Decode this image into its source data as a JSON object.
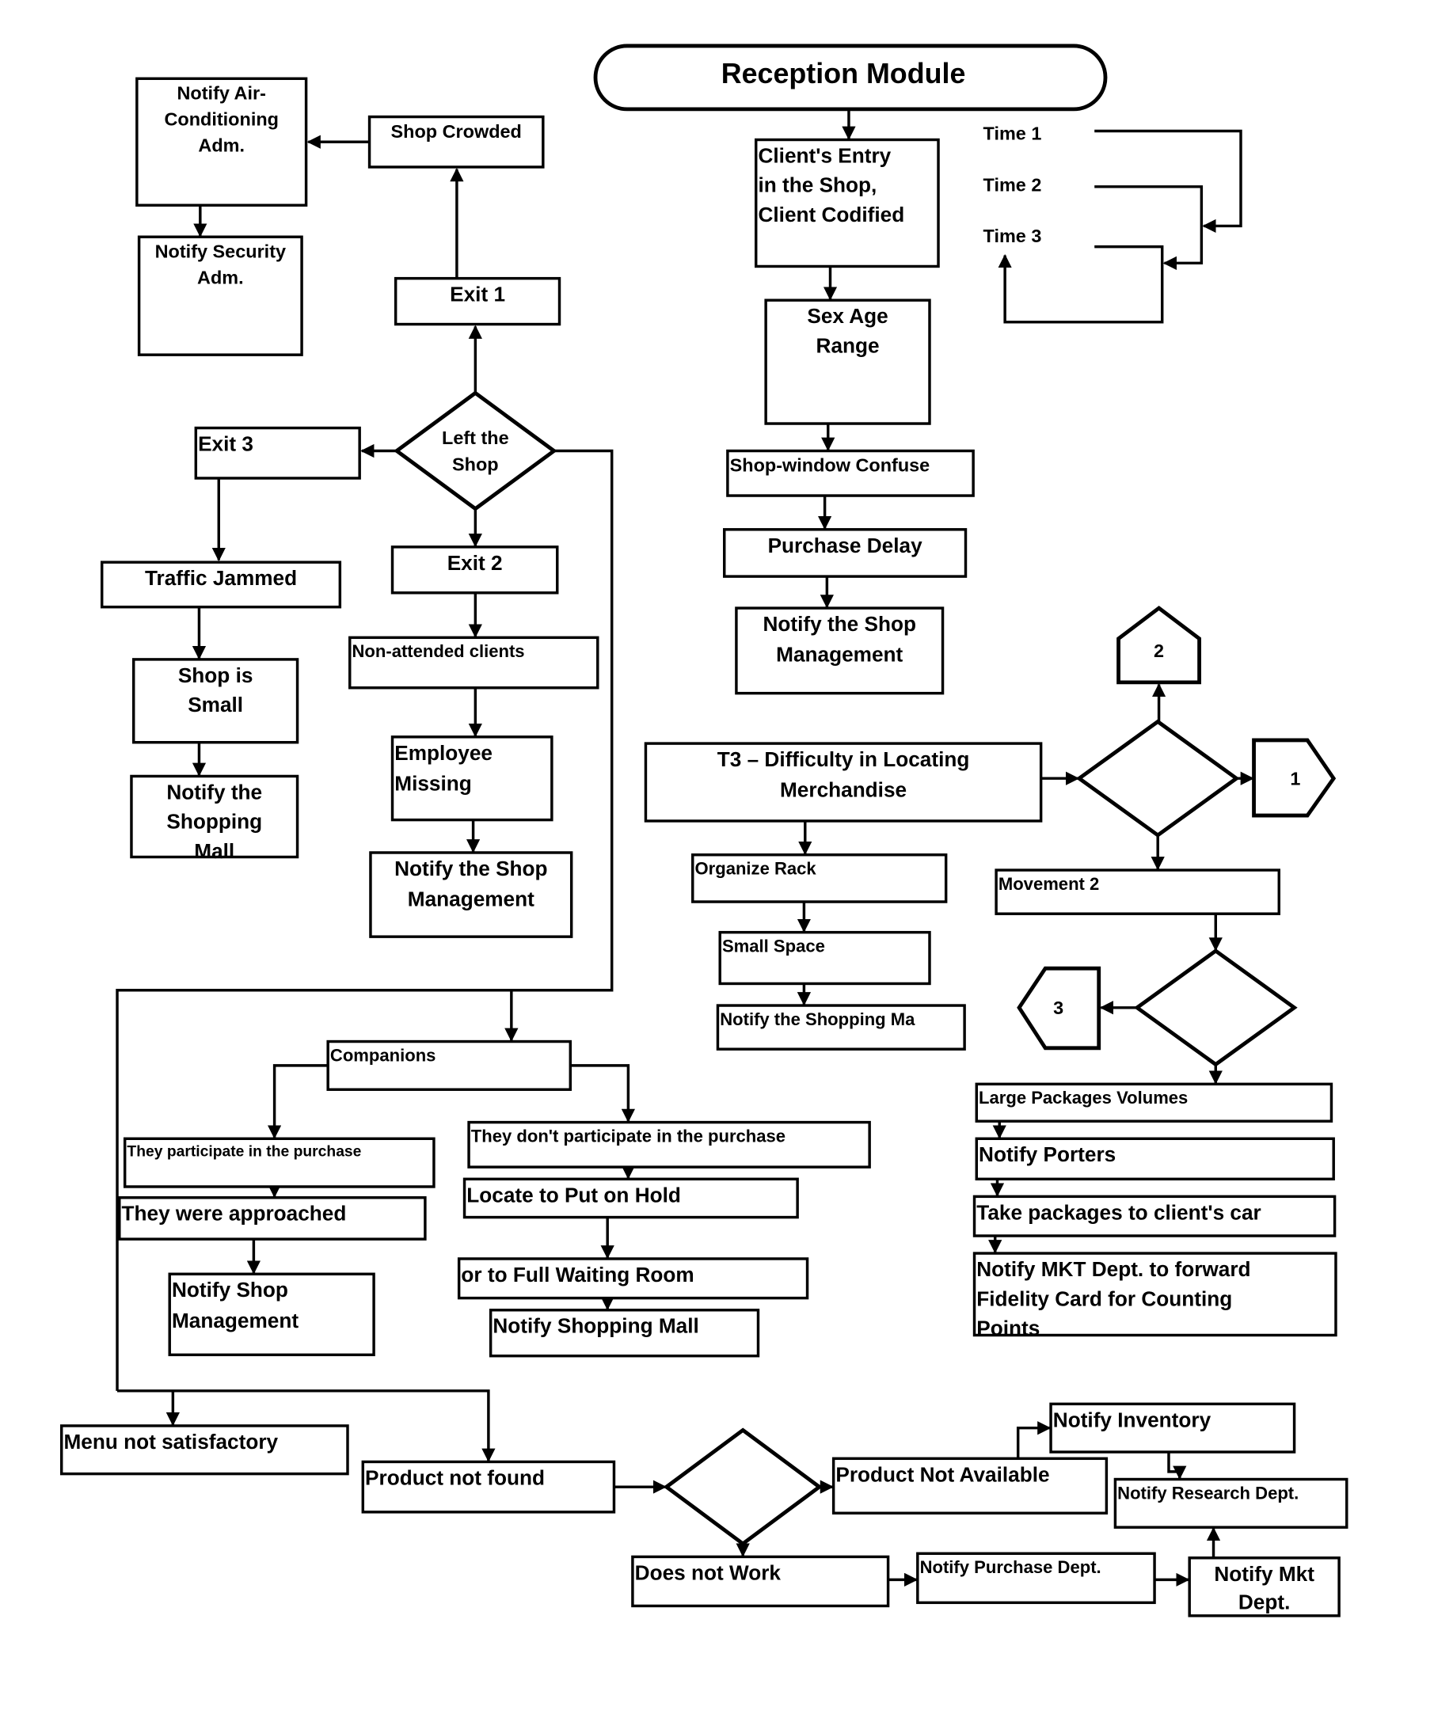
{
  "diagram": {
    "title": "Reception Module",
    "colors": {
      "stroke": "#000000",
      "background": "#ffffff",
      "text": "#000000"
    },
    "timers": [
      "Time 1",
      "Time 2",
      "Time 3"
    ],
    "connectors": [
      "2",
      "1",
      "3"
    ],
    "nodes": {
      "notify_ac": [
        "Notify Air-",
        "Conditioning",
        "Adm."
      ],
      "notify_security": [
        "Notify Security",
        "Adm."
      ],
      "shop_crowded": [
        "Shop Crowded"
      ],
      "exit1": [
        "Exit 1"
      ],
      "left_shop": [
        "Left the",
        "Shop"
      ],
      "exit3": [
        "Exit 3"
      ],
      "exit2": [
        "Exit 2"
      ],
      "traffic_jammed": [
        "Traffic Jammed"
      ],
      "shop_small": [
        "Shop is",
        "Small"
      ],
      "notify_mall_1": [
        "Notify the",
        "Shopping",
        "Mall"
      ],
      "non_attended": [
        "Non-attended clients"
      ],
      "employee_missing": [
        "Employee",
        "Missing"
      ],
      "notify_shop_mgmt_1": [
        "Notify the Shop",
        "Management"
      ],
      "client_entry": [
        "Client's Entry",
        "in the Shop,",
        "Client Codified"
      ],
      "sex_age": [
        "Sex Age",
        "Range"
      ],
      "shop_window": [
        "Shop-window Confuse"
      ],
      "purchase_delay": [
        "Purchase Delay"
      ],
      "notify_shop_mgmt_2": [
        "Notify the Shop",
        "Management"
      ],
      "t3_difficulty": [
        "T3 – Difficulty in Locating",
        "Merchandise"
      ],
      "organize_rack": [
        "Organize Rack"
      ],
      "small_space": [
        "Small Space"
      ],
      "notify_mall_2": [
        "Notify the Shopping Ma"
      ],
      "movement2": [
        "Movement 2"
      ],
      "large_packages": [
        "Large Packages Volumes"
      ],
      "notify_porters": [
        "Notify Porters"
      ],
      "take_packages": [
        "Take packages to client's car"
      ],
      "notify_mkt_fidelity": [
        "Notify MKT Dept. to forward",
        "Fidelity Card for Counting",
        "Points"
      ],
      "companions": [
        "Companions"
      ],
      "participate": [
        "They participate in the purchase"
      ],
      "approached": [
        "They were approached"
      ],
      "notify_shop_mgmt_3": [
        "Notify Shop",
        "Management"
      ],
      "not_participate": [
        "They don't participate in the purchase"
      ],
      "locate_hold": [
        "Locate to Put on Hold"
      ],
      "full_waiting": [
        "or to Full Waiting Room"
      ],
      "notify_mall_3": [
        "Notify Shopping Mall"
      ],
      "menu_not_satisfactory": [
        "Menu not satisfactory"
      ],
      "product_not_found": [
        "Product not found"
      ],
      "product_not_available": [
        "Product Not Available"
      ],
      "does_not_work": [
        "Does not Work"
      ],
      "notify_inventory": [
        "Notify Inventory"
      ],
      "notify_research": [
        "Notify Research Dept."
      ],
      "notify_purchase": [
        "Notify Purchase Dept."
      ],
      "notify_mkt": [
        "Notify Mkt",
        "Dept."
      ]
    }
  }
}
